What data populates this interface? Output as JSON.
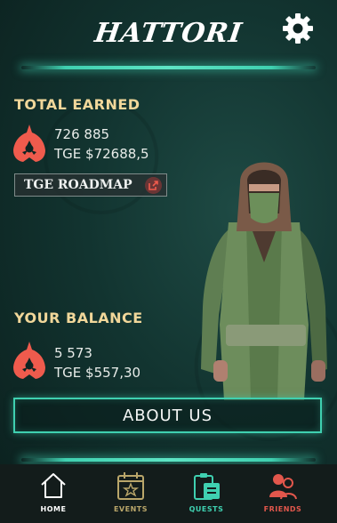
{
  "header": {
    "logo": "HATTORI"
  },
  "total_earned": {
    "title": "TOTAL EARNED",
    "amount": "726 885",
    "tge": "TGE $72688,5"
  },
  "roadmap": {
    "label": "TGE ROADMAP"
  },
  "balance": {
    "title": "YOUR BALANCE",
    "amount": "5 573",
    "tge": "TGE $557,30"
  },
  "about": {
    "label": "ABOUT US"
  },
  "nav": {
    "items": [
      {
        "label": "HOME",
        "color": "#ffffff",
        "icon": "home-icon"
      },
      {
        "label": "EVENTS",
        "color": "#b9a66a",
        "icon": "calendar-star-icon"
      },
      {
        "label": "QUESTS",
        "color": "#3fd0b0",
        "icon": "quests-icon"
      },
      {
        "label": "FRIENDS",
        "color": "#e2574c",
        "icon": "friends-icon"
      }
    ]
  },
  "colors": {
    "accent": "#3fd0b0",
    "gold": "#f1d79a",
    "shuriken": "#ef5b4d"
  }
}
